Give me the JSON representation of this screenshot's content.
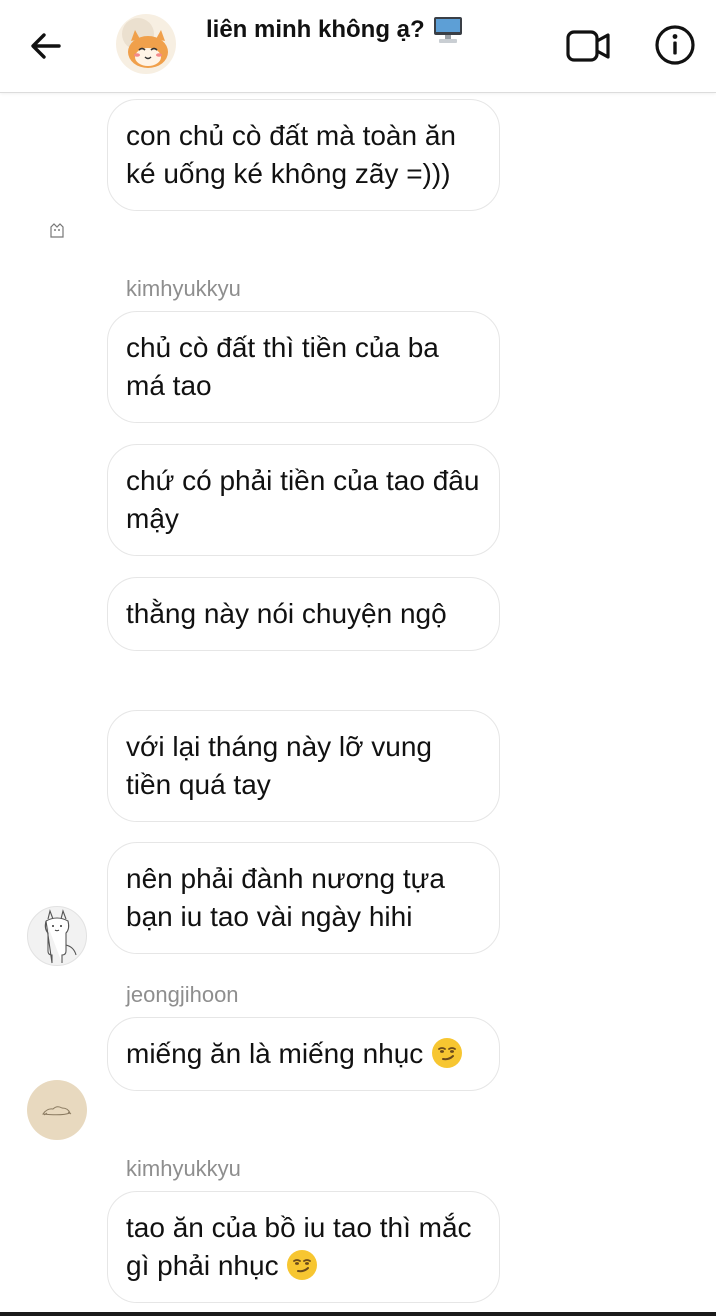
{
  "header": {
    "title": "liên minh không ạ?",
    "title_icon": "desktop-computer-emoji",
    "back_icon": "arrow-left-icon",
    "video_icon": "video-camera-icon",
    "info_icon": "info-icon"
  },
  "messages": [
    {
      "text": "con chủ cò đất mà toàn ăn ké uống ké không zãy =)))"
    },
    {
      "sender": "kimhyukkyu"
    },
    {
      "text": "chủ cò đất thì tiền của ba má tao"
    },
    {
      "text": "chứ có phải tiền của tao đâu mậy"
    },
    {
      "text": "thằng này nói chuyện ngộ"
    },
    {
      "text": "với lại tháng này lỡ vung tiền quá tay"
    },
    {
      "text": "nên phải đành nương tựa bạn iu tao vài ngày hihi"
    },
    {
      "sender": "jeongjihoon"
    },
    {
      "text": "miếng ăn là miếng nhục",
      "emoji": "smirking-face-emoji"
    },
    {
      "sender": "kimhyukkyu"
    },
    {
      "text": "tao ăn của bồ iu tao thì mắc gì phải nhục",
      "emoji": "smirking-face-emoji"
    }
  ],
  "colors": {
    "bubble_border": "#e6e6e6",
    "sender_text": "#8e8e8e",
    "emoji_yellow": "#f7c631"
  }
}
